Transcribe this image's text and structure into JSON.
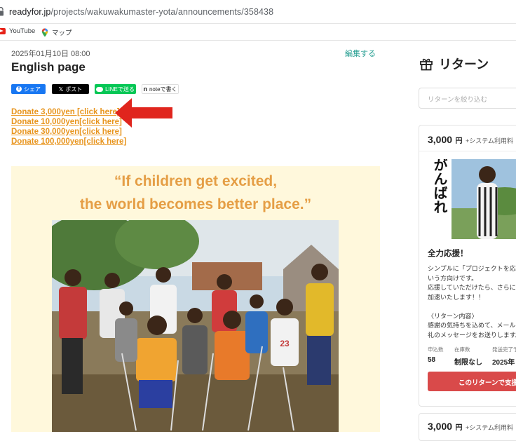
{
  "browser": {
    "url_host": "readyfor.jp",
    "url_path": "/projects/wakuwakumaster-yota/announcements/358438",
    "bookmarks": [
      {
        "label": "YouTube",
        "icon": "youtube-icon"
      },
      {
        "label": "マップ",
        "icon": "google-maps-icon"
      }
    ]
  },
  "article": {
    "date": "2025年01月10日 08:00",
    "edit_label": "編集する",
    "title": "English page",
    "share": {
      "facebook": "シェア",
      "x": "ポスト",
      "line": "LINEで送る",
      "note": "noteで書く"
    },
    "donate_links": [
      "Donate 3,000yen [click here]",
      "Donate 10,000yen[click here]",
      "Donate 30,000yen[click here]",
      "Donate 100,000yen[click here]"
    ],
    "poster": {
      "quote_line1": "“If children get excited,",
      "quote_line2": "the world becomes better place.”",
      "jersey_text": "23"
    }
  },
  "sidebar": {
    "title": "リターン",
    "filter_placeholder": "リターンを絞り込む",
    "cards": [
      {
        "price": "3,000",
        "yen": "円",
        "fee": "+システム利用料",
        "image_text": "がんばれ",
        "heading": "全力応援！",
        "body_lines": [
          "シンプルに「プロジェクトを応援",
          "いう方向けです。",
          "応援していただけたら、さらにフ",
          "加速いたします！！",
          "",
          "〈リターン内容〉",
          "感謝の気持ちを込めて、メールに",
          "礼のメッセージをお送りします。"
        ],
        "stats": [
          {
            "label": "申込数",
            "value": "58"
          },
          {
            "label": "在庫数",
            "value": "制限なし"
          },
          {
            "label": "発送完了予",
            "value": "2025年"
          }
        ],
        "button": "このリターンで支援す"
      },
      {
        "price": "3,000",
        "yen": "円",
        "fee": "+システム利用料"
      }
    ]
  },
  "colors": {
    "donate_link": "#e8951e",
    "edit_link": "#1f9b8e",
    "support_button": "#d94a4a",
    "poster_bg": "#fff8dc",
    "quote": "#e59e45",
    "arrow": "#e0251d"
  }
}
